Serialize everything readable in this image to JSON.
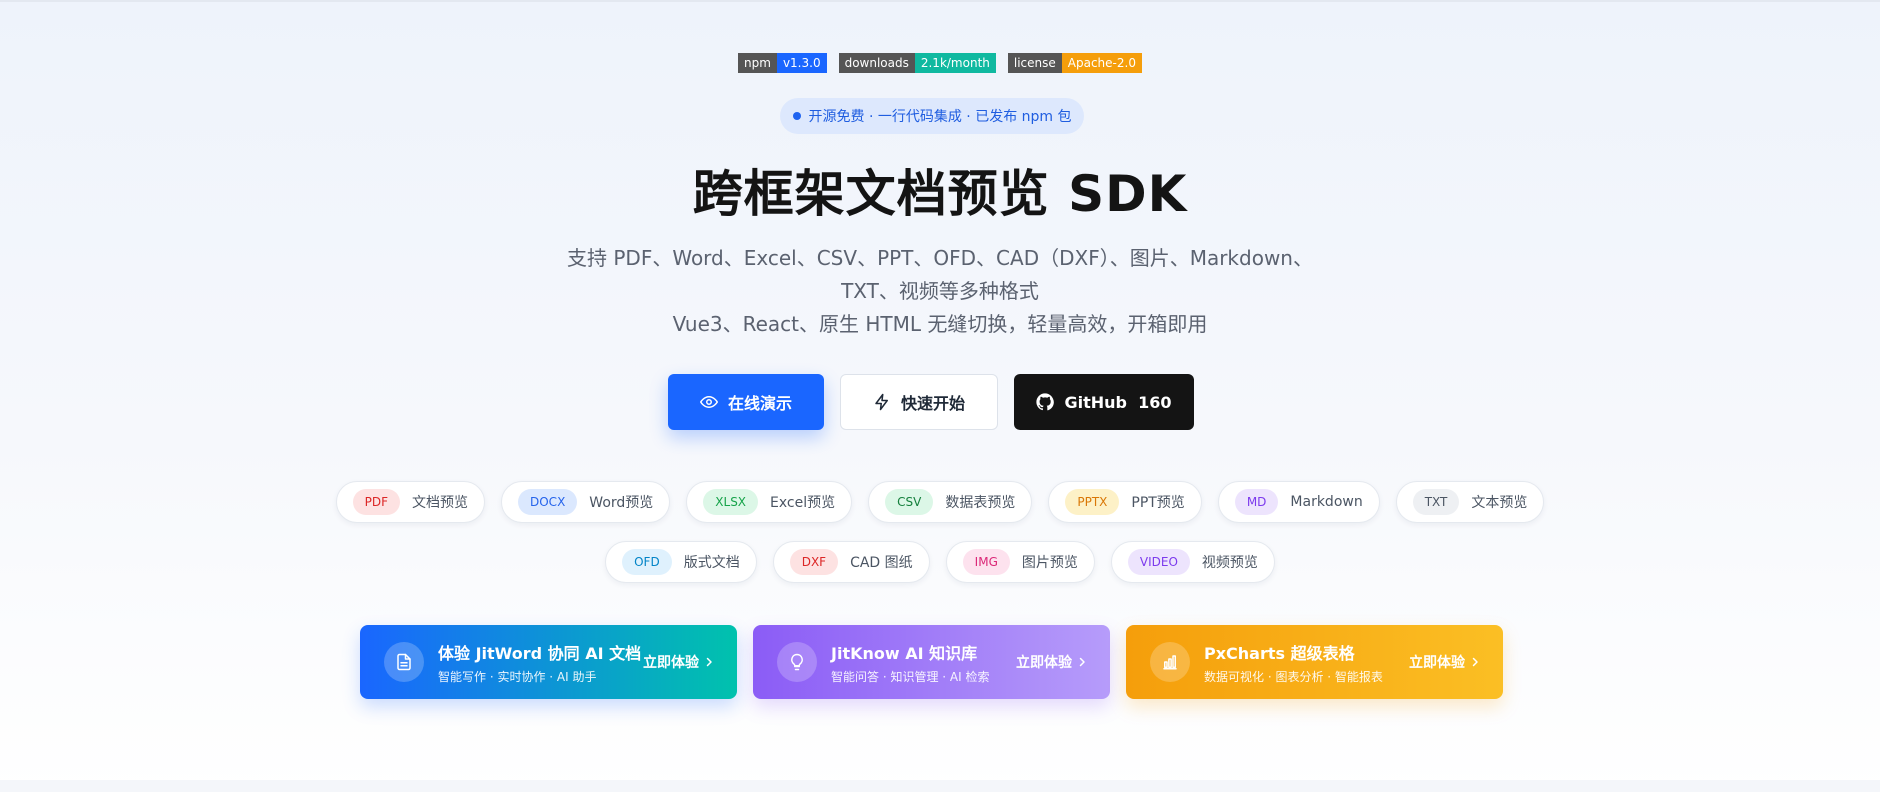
{
  "badges": [
    {
      "key": "npm",
      "value": "v1.3.0",
      "color": "#1a66ff"
    },
    {
      "key": "downloads",
      "value": "2.1k/month",
      "color": "#10b9a0"
    },
    {
      "key": "license",
      "value": "Apache-2.0",
      "color": "#f59e0b"
    }
  ],
  "pill": {
    "text": "开源免费 · 一行代码集成 · 已发布 npm 包"
  },
  "hero": {
    "title": "跨框架文档预览 SDK",
    "subtitle_line1": "支持 PDF、Word、Excel、CSV、PPT、OFD、CAD（DXF）、图片、Markdown、TXT、视频等多种格式",
    "subtitle_line2": "Vue3、React、原生 HTML 无缝切换，轻量高效，开箱即用"
  },
  "actions": {
    "demo": {
      "label": "在线演示",
      "icon": "eye-icon"
    },
    "quickstart": {
      "label": "快速开始",
      "icon": "lightning-icon"
    },
    "github": {
      "label": "GitHub  160",
      "icon": "github-icon"
    }
  },
  "formats_row1": [
    {
      "tag": "PDF",
      "label": "文档预览",
      "bg": "#fde2e2",
      "fg": "#dc2626"
    },
    {
      "tag": "DOCX",
      "label": "Word预览",
      "bg": "#dbe8fe",
      "fg": "#2563eb"
    },
    {
      "tag": "XLSX",
      "label": "Excel预览",
      "bg": "#dcf7e7",
      "fg": "#16a34a"
    },
    {
      "tag": "CSV",
      "label": "数据表预览",
      "bg": "#dcf7e7",
      "fg": "#15803d"
    },
    {
      "tag": "PPTX",
      "label": "PPT预览",
      "bg": "#fdf1c7",
      "fg": "#d97706"
    },
    {
      "tag": "MD",
      "label": "Markdown",
      "bg": "#ede4fd",
      "fg": "#7c3aed"
    },
    {
      "tag": "TXT",
      "label": "文本预览",
      "bg": "#eef0f3",
      "fg": "#4b5563"
    }
  ],
  "formats_row2": [
    {
      "tag": "OFD",
      "label": "版式文档",
      "bg": "#dff1fd",
      "fg": "#0284c7"
    },
    {
      "tag": "DXF",
      "label": "CAD 图纸",
      "bg": "#fde2e2",
      "fg": "#dc2626"
    },
    {
      "tag": "IMG",
      "label": "图片预览",
      "bg": "#fde2ee",
      "fg": "#db2777"
    },
    {
      "tag": "VIDEO",
      "label": "视频预览",
      "bg": "#ede4fd",
      "fg": "#7c3aed"
    }
  ],
  "cards": [
    {
      "title": "体验 JitWord 协同 AI 文档",
      "subtitle": "智能写作 · 实时协作 · AI 助手",
      "cta": "立即体验",
      "icon": "document-icon"
    },
    {
      "title": "JitKnow AI 知识库",
      "subtitle": "智能问答 · 知识管理 · AI 检索",
      "cta": "立即体验",
      "icon": "lightbulb-icon"
    },
    {
      "title": "PxCharts 超级表格",
      "subtitle": "数据可视化 · 图表分析 · 智能报表",
      "cta": "立即体验",
      "icon": "bar-chart-icon"
    }
  ]
}
